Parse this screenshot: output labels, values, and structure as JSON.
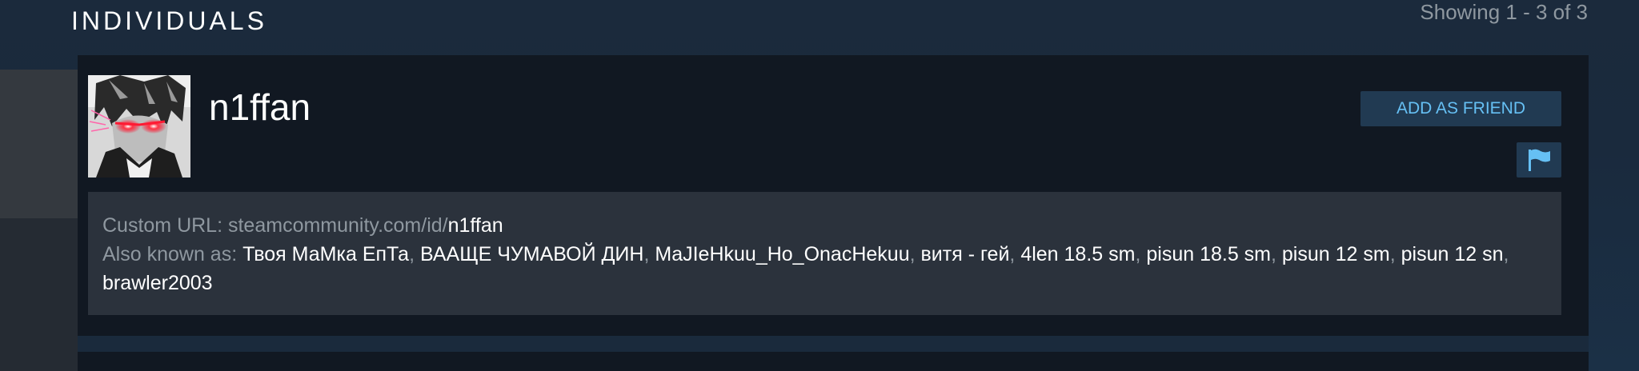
{
  "section": {
    "title": "INDIVIDUALS",
    "showing": "Showing 1 - 3 of 3"
  },
  "result": {
    "username": "n1ffan",
    "add_friend_label": "ADD AS FRIEND",
    "avatar_icon": "anime-avatar-image",
    "flag_icon": "flag-icon",
    "custom_url_label": "Custom URL: ",
    "custom_url_base": "steamcommunity.com/id/",
    "custom_url_id": "n1ffan",
    "aka_label": "Also known as: ",
    "aliases": [
      "Твоя МаМка ЕпТа",
      "ВААЩЕ ЧУМАВОЙ ДИН",
      "MaJIeHkuu_Ho_OnacHekuu",
      "витя - гей",
      "4len 18.5 sm",
      "pisun 18.5 sm",
      "pisun 12 sm",
      "pisun 12 sn",
      "brawler2003"
    ],
    "alias_separator": ", "
  },
  "colors": {
    "accent": "#66c0f4",
    "button_bg": "#213a52",
    "card_bg": "#111822",
    "details_bg": "#2b323c",
    "muted_text": "#8f98a0"
  }
}
